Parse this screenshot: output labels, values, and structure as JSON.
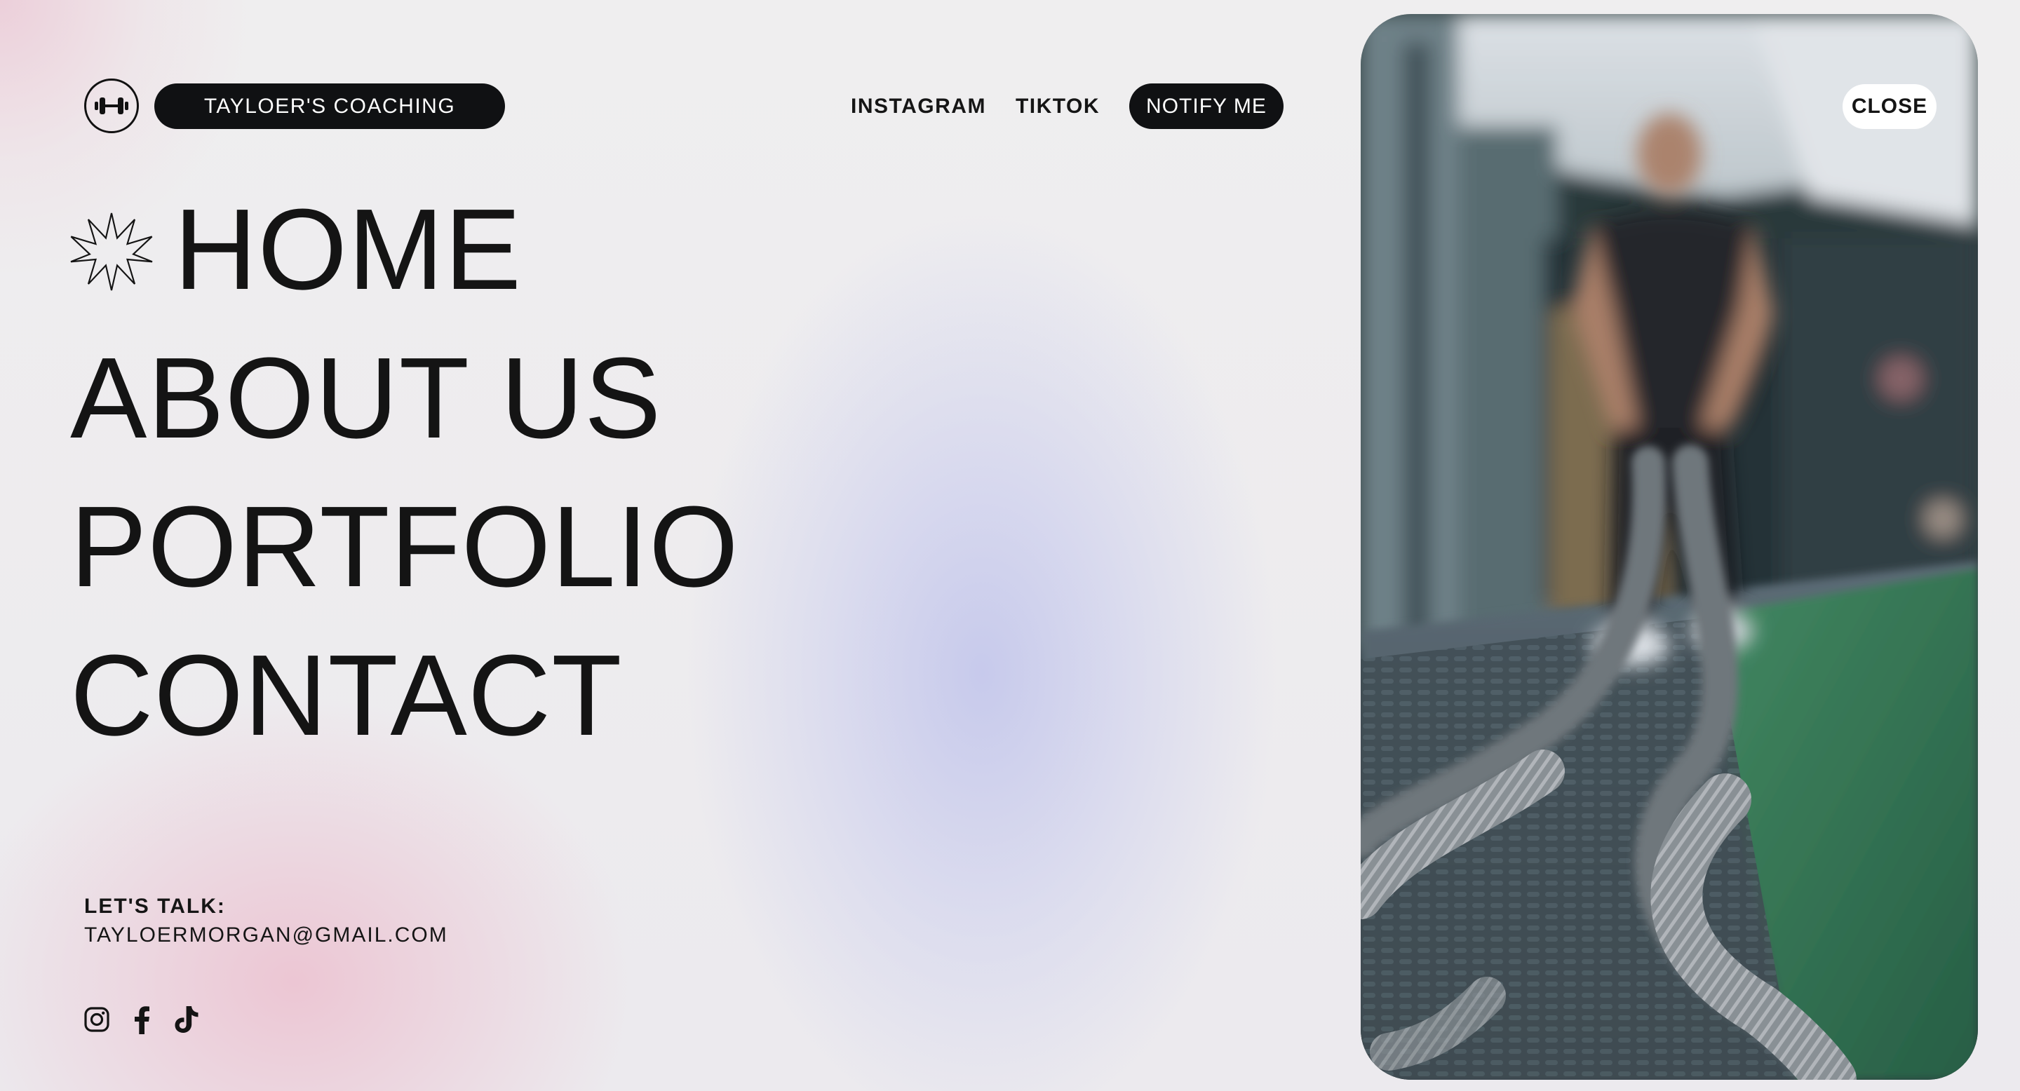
{
  "header": {
    "logo_icon": "dumbbell-icon",
    "brand": "TAYLOER'S COACHING",
    "nav": {
      "instagram": "INSTAGRAM",
      "tiktok": "TIKTOK",
      "notify": "NOTIFY ME"
    }
  },
  "menu": {
    "items": [
      {
        "label": "HOME",
        "icon": "starburst-icon"
      },
      {
        "label": "ABOUT US"
      },
      {
        "label": "PORTFOLIO"
      },
      {
        "label": "CONTACT"
      }
    ]
  },
  "contact": {
    "label": "LET'S TALK:",
    "email": "TAYLOERMORGAN@GMAIL.COM"
  },
  "socials": [
    "instagram-icon",
    "facebook-icon",
    "tiktok-icon"
  ],
  "photo": {
    "subject": "battle-ropes-workout-photo",
    "close_label": "CLOSE"
  },
  "colors": {
    "pill_dark": "#101113",
    "text": "#151515",
    "pink_glow": "#ecc4d2",
    "lavender_glow": "#c5c8ec",
    "turf_green": "#2f7a4c"
  }
}
